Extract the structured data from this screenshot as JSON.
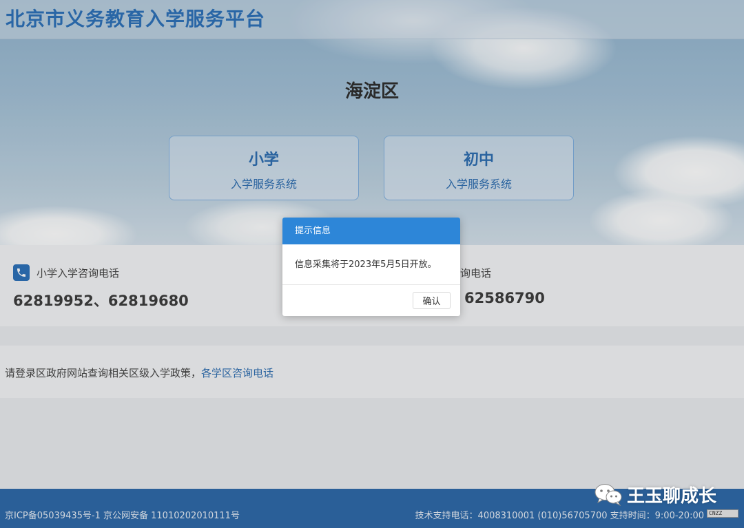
{
  "header": {
    "site_title": "北京市义务教育入学服务平台"
  },
  "main": {
    "district": "海淀区",
    "systems": [
      {
        "title": "小学",
        "subtitle": "入学服务系统"
      },
      {
        "title": "初中",
        "subtitle": "入学服务系统"
      }
    ]
  },
  "contacts": {
    "primary": {
      "label": "小学入学咨询电话",
      "number": "62819952、62819680"
    },
    "junior": {
      "label": "询电话",
      "number": "62586790"
    }
  },
  "policy": {
    "text": "请登录区政府网站查询相关区级入学政策，",
    "link": "各学区咨询电话"
  },
  "footer": {
    "icp": "京ICP备05039435号-1 京公网安备 11010202010111号",
    "support": "技术支持电话：4008310001 (010)56705700 支持时间：9:00-20:00",
    "badge": "CNZZ"
  },
  "modal": {
    "title": "提示信息",
    "message": "信息采集将于2023年5月5日开放。",
    "confirm_label": "确认"
  },
  "watermark": {
    "text": "王玉聊成长",
    "icon": "wechat-icon"
  },
  "colors": {
    "brand": "#2a6fb8",
    "modal_header": "#2d86d8",
    "footer": "#2b67a8"
  }
}
